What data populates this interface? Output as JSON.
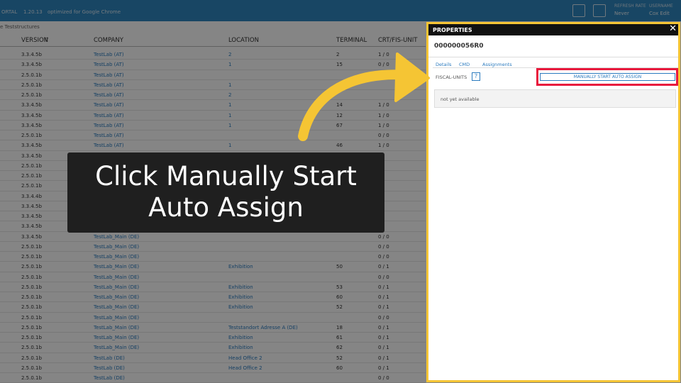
{
  "topbar": {
    "brand": "ORTAL",
    "version": "1.20.13",
    "optimized": "optimized for Google Chrome",
    "refresh_label": "REFRESH RATE",
    "refresh_value": "Never",
    "user_label": "USERNAME",
    "user_value": "Cox Edit"
  },
  "breadcrumb": "e Teststructures",
  "table": {
    "headers": [
      "VERSION",
      "COMPANY",
      "LOCATION",
      "TERMINAL",
      "CRT/FIS-UNIT"
    ],
    "rows": [
      [
        "3.3.4.5b",
        "TestLab (AT)",
        "2",
        "2",
        "1 / 0"
      ],
      [
        "3.3.4.5b",
        "TestLab (AT)",
        "1",
        "15",
        "0 / 0"
      ],
      [
        "2.5.0.1b",
        "TestLab (AT)",
        "",
        "",
        ""
      ],
      [
        "2.5.0.1b",
        "TestLab (AT)",
        "1",
        "",
        ""
      ],
      [
        "2.5.0.1b",
        "TestLab (AT)",
        "2",
        "",
        ""
      ],
      [
        "3.3.4.5b",
        "TestLab (AT)",
        "1",
        "14",
        "1 / 0"
      ],
      [
        "3.3.4.5b",
        "TestLab (AT)",
        "1",
        "12",
        "1 / 0"
      ],
      [
        "3.3.4.5b",
        "TestLab (AT)",
        "1",
        "67",
        "1 / 0"
      ],
      [
        "2.5.0.1b",
        "TestLab (AT)",
        "",
        "",
        "0 / 0"
      ],
      [
        "3.3.4.5b",
        "TestLab (AT)",
        "1",
        "46",
        "1 / 0"
      ],
      [
        "3.3.4.5b",
        "",
        "",
        "",
        ""
      ],
      [
        "2.5.0.1b",
        "",
        "",
        "",
        ""
      ],
      [
        "2.5.0.1b",
        "",
        "",
        "",
        ""
      ],
      [
        "2.5.0.1b",
        "",
        "",
        "",
        ""
      ],
      [
        "3.3.4.4b",
        "",
        "",
        "",
        ""
      ],
      [
        "3.3.4.5b",
        "",
        "",
        "",
        ""
      ],
      [
        "3.3.4.5b",
        "",
        "",
        "",
        ""
      ],
      [
        "3.3.4.5b",
        "",
        "",
        "",
        ""
      ],
      [
        "3.3.4.5b",
        "TestLab_Main (DE)",
        "",
        "",
        "0 / 0"
      ],
      [
        "2.5.0.1b",
        "TestLab_Main (DE)",
        "",
        "",
        "0 / 0"
      ],
      [
        "2.5.0.1b",
        "TestLab_Main (DE)",
        "",
        "",
        "0 / 0"
      ],
      [
        "2.5.0.1b",
        "TestLab_Main (DE)",
        "Exhibition",
        "50",
        "0 / 1"
      ],
      [
        "2.5.0.1b",
        "TestLab_Main (DE)",
        "",
        "",
        "0 / 0"
      ],
      [
        "2.5.0.1b",
        "TestLab_Main (DE)",
        "Exhibition",
        "53",
        "0 / 1"
      ],
      [
        "2.5.0.1b",
        "TestLab_Main (DE)",
        "Exhibition",
        "60",
        "0 / 1"
      ],
      [
        "2.5.0.1b",
        "TestLab_Main (DE)",
        "Exhibition",
        "52",
        "0 / 1"
      ],
      [
        "2.5.0.1b",
        "TestLab_Main (DE)",
        "",
        "",
        "0 / 0"
      ],
      [
        "2.5.0.1b",
        "TestLab_Main (DE)",
        "Teststandort Adresse A (DE)",
        "18",
        "0 / 1"
      ],
      [
        "2.5.0.1b",
        "TestLab_Main (DE)",
        "Exhibition",
        "61",
        "0 / 1"
      ],
      [
        "2.5.0.1b",
        "TestLab_Main (DE)",
        "Exhibition",
        "62",
        "0 / 1"
      ],
      [
        "2.5.0.1b",
        "TestLab (DE)",
        "Head Office 2",
        "52",
        "0 / 1"
      ],
      [
        "2.5.0.1b",
        "TestLab (DE)",
        "Head Office 2",
        "60",
        "0 / 1"
      ],
      [
        "2.5.0.1b",
        "TestLab (DE)",
        "",
        "",
        "0 / 0"
      ]
    ]
  },
  "panel": {
    "title": "PROPERTIES",
    "id": "000000056R0",
    "tabs": [
      "Details",
      "CMD",
      "Assignments"
    ],
    "fiscal_units_label": "FISCAL-UNITS",
    "help_glyph": "?",
    "auto_assign_label": "MANUALLY START AUTO ASSIGN",
    "not_available": "not yet available"
  },
  "caption": {
    "line1": "Click Manually Start",
    "line2": "Auto Assign"
  },
  "colors": {
    "topbar": "#2e87c0",
    "highlight_border": "#f5c534",
    "target_box": "#e8183c",
    "arrow": "#f5c534",
    "link": "#2b7bbf"
  }
}
